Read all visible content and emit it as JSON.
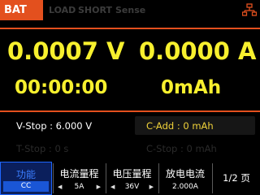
{
  "header": {
    "mode": "BAT",
    "flags": [
      "LOAD",
      "SHORT",
      "Sense"
    ]
  },
  "readouts": {
    "voltage": "0.0007 V",
    "current": "0.0000 A",
    "elapsed": "00:00:00",
    "capacity": "0mAh"
  },
  "params": {
    "vstop": "V-Stop :  6.000 V",
    "cadd": "C-Add : 0 mAh",
    "tstop": "T-Stop :      0 s",
    "cstop": "C-Stop :     0 mAh"
  },
  "softkeys": [
    {
      "title": "功能",
      "value": "CC"
    },
    {
      "title": "电流量程",
      "value": "5A"
    },
    {
      "title": "电压量程",
      "value": "36V"
    },
    {
      "title": "放电电流",
      "value": "2.000A"
    }
  ],
  "page": "1/2 页",
  "colors": {
    "accent": "#e3501e",
    "readout": "#f7f02e",
    "active_key": "#1e66ff"
  },
  "icons": {
    "network": "network-icon"
  }
}
